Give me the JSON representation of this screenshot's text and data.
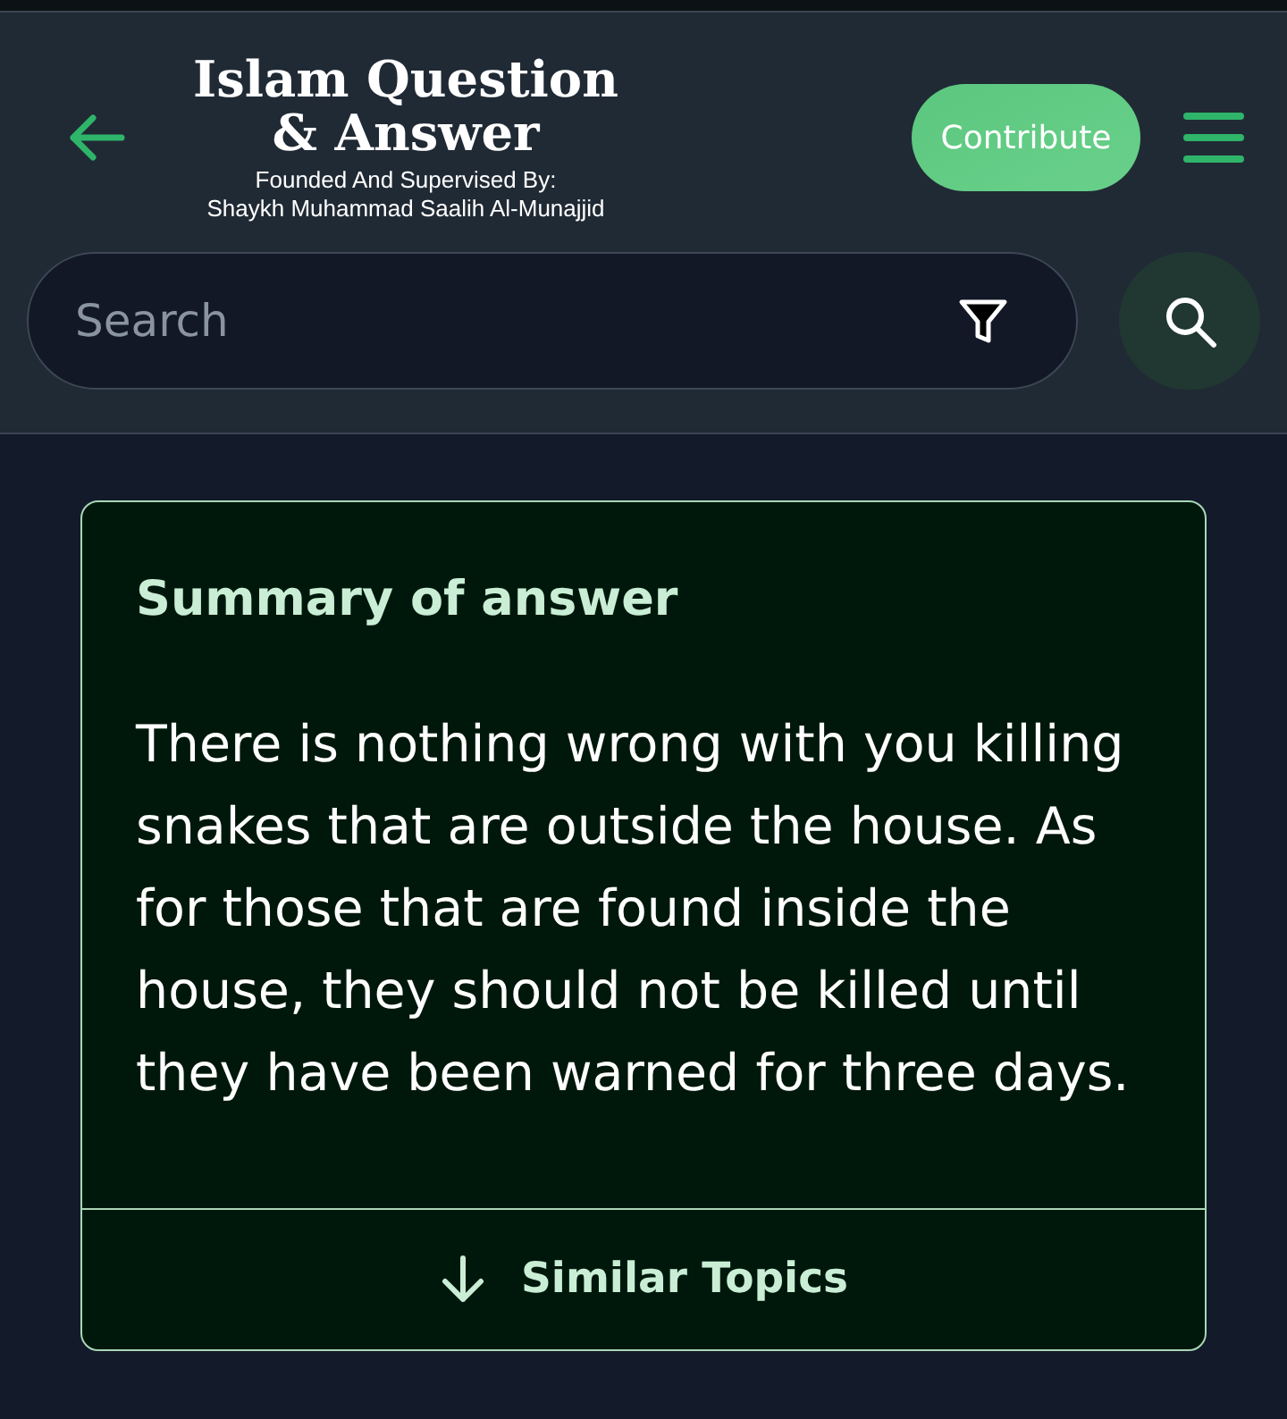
{
  "header": {
    "logo": {
      "title": "Islam Question & Answer",
      "subtitle_lines": [
        "Founded And Supervised By:",
        "Shaykh Muhammad Saalih Al-Munajjid"
      ]
    },
    "contribute_button": "Contribute"
  },
  "search": {
    "placeholder": "Search"
  },
  "summary_card": {
    "title": "Summary of answer",
    "text": "There is nothing wrong with you killing snakes that are outside the house. As for those that are found inside the house, they should not be killed until they have been warned for three days.",
    "footer_link": "Similar Topics"
  }
}
